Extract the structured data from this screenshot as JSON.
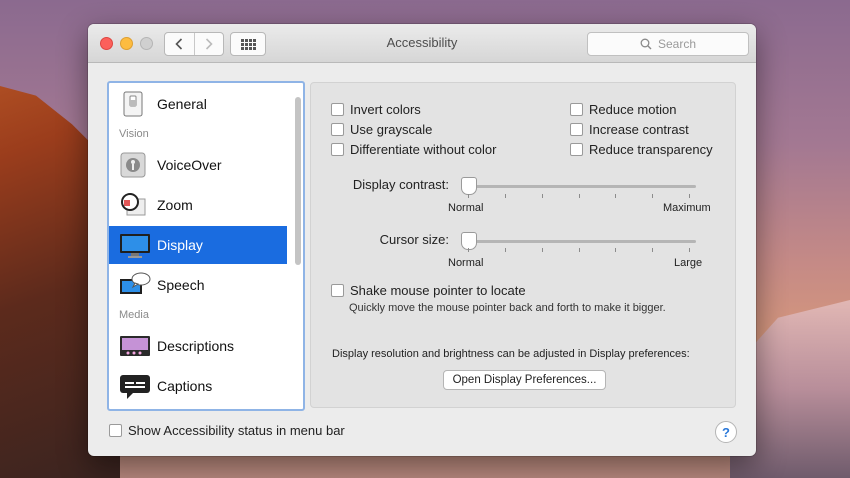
{
  "window": {
    "title": "Accessibility"
  },
  "search": {
    "placeholder": "Search"
  },
  "sidebar": {
    "items": [
      {
        "label": "General",
        "icon": "general-icon"
      },
      {
        "section": "Vision"
      },
      {
        "label": "VoiceOver",
        "icon": "voiceover-icon"
      },
      {
        "label": "Zoom",
        "icon": "zoom-icon"
      },
      {
        "label": "Display",
        "icon": "display-icon",
        "selected": true
      },
      {
        "label": "Speech",
        "icon": "speech-icon"
      },
      {
        "section": "Media"
      },
      {
        "label": "Descriptions",
        "icon": "descriptions-icon"
      },
      {
        "label": "Captions",
        "icon": "captions-icon"
      }
    ]
  },
  "display": {
    "options_left": [
      "Invert colors",
      "Use grayscale",
      "Differentiate without color"
    ],
    "options_right": [
      "Reduce motion",
      "Increase contrast",
      "Reduce transparency"
    ],
    "contrast": {
      "label": "Display contrast:",
      "min_label": "Normal",
      "max_label": "Maximum",
      "value": 0
    },
    "cursor": {
      "label": "Cursor size:",
      "min_label": "Normal",
      "max_label": "Large",
      "value": 0
    },
    "shake": {
      "label": "Shake mouse pointer to locate",
      "description": "Quickly move the mouse pointer back and forth to make it bigger."
    },
    "resolution_note": "Display resolution and brightness can be adjusted in Display preferences:",
    "open_button": "Open Display Preferences..."
  },
  "footer": {
    "status_checkbox": "Show Accessibility status in menu bar",
    "help": "?"
  },
  "colors": {
    "accent": "#1a6ce0"
  }
}
